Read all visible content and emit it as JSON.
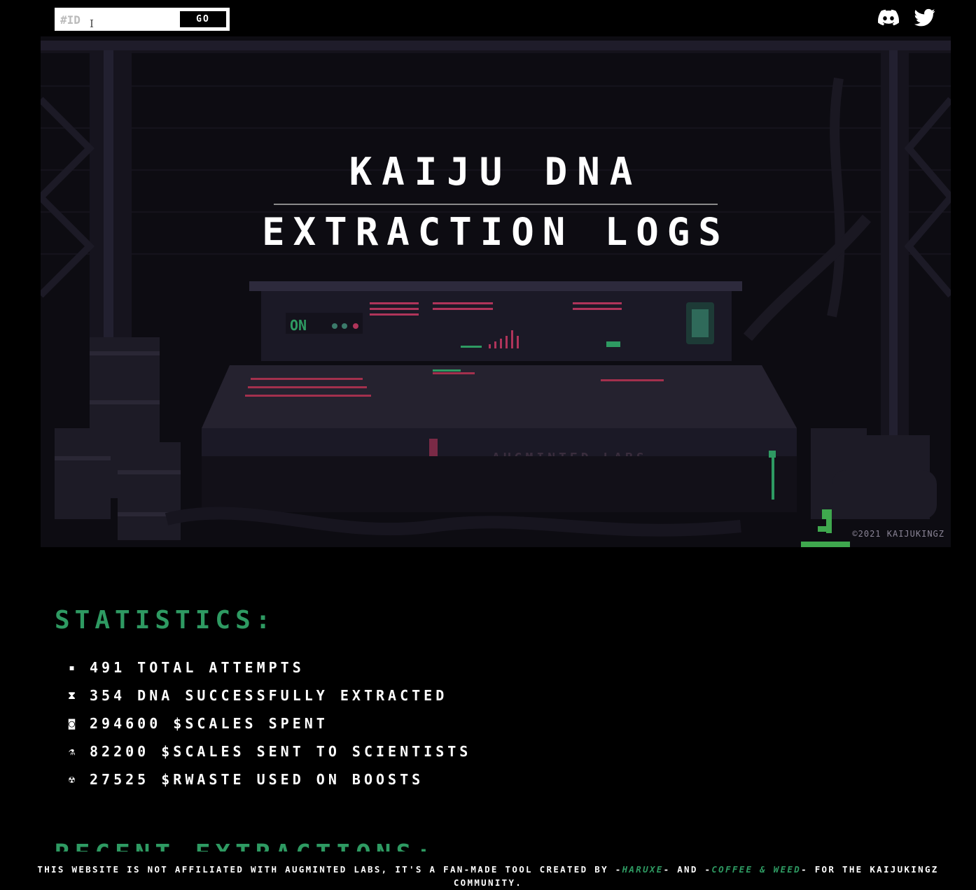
{
  "search": {
    "placeholder": "#ID",
    "go_label": "GO"
  },
  "social": [
    {
      "name": "discord",
      "icon": "discord-icon"
    },
    {
      "name": "twitter",
      "icon": "twitter-icon"
    }
  ],
  "hero": {
    "title_line1": "KAIJU DNA",
    "title_line2": "EXTRACTION LOGS",
    "copyright": "©2021 KAIJUKINGZ",
    "panel_text": "ON",
    "console_label": "AUGMINTED LABS"
  },
  "statistics": {
    "heading": "STATISTICS:",
    "items": [
      {
        "icon": "document-icon",
        "value": "491",
        "label": "TOTAL ATTEMPTS"
      },
      {
        "icon": "hourglass-icon",
        "value": "354",
        "label": "DNA SUCCESSFULLY EXTRACTED"
      },
      {
        "icon": "coin-icon",
        "value": "294600",
        "label": "$SCALES SPENT"
      },
      {
        "icon": "flask-icon",
        "value": "82200",
        "label": "$SCALES SENT TO SCIENTISTS"
      },
      {
        "icon": "radiation-icon",
        "value": "27525",
        "label": "$RWASTE USED ON BOOSTS"
      }
    ]
  },
  "recent": {
    "heading": "RECENT EXTRACTIONS:"
  },
  "footer": {
    "text_before": "THIS WEBSITE IS NOT AFFILIATED WITH AUGMINTED LABS, IT'S A FAN-MADE TOOL CREATED BY -",
    "author1": "HARUXE",
    "text_and": "- AND -",
    "author2": "COFFEE & WEED",
    "text_after": "- FOR THE KAIJUKINGZ COMMUNITY."
  },
  "colors": {
    "accent": "#2e9a62",
    "background": "#000000",
    "text": "#ffffff"
  }
}
